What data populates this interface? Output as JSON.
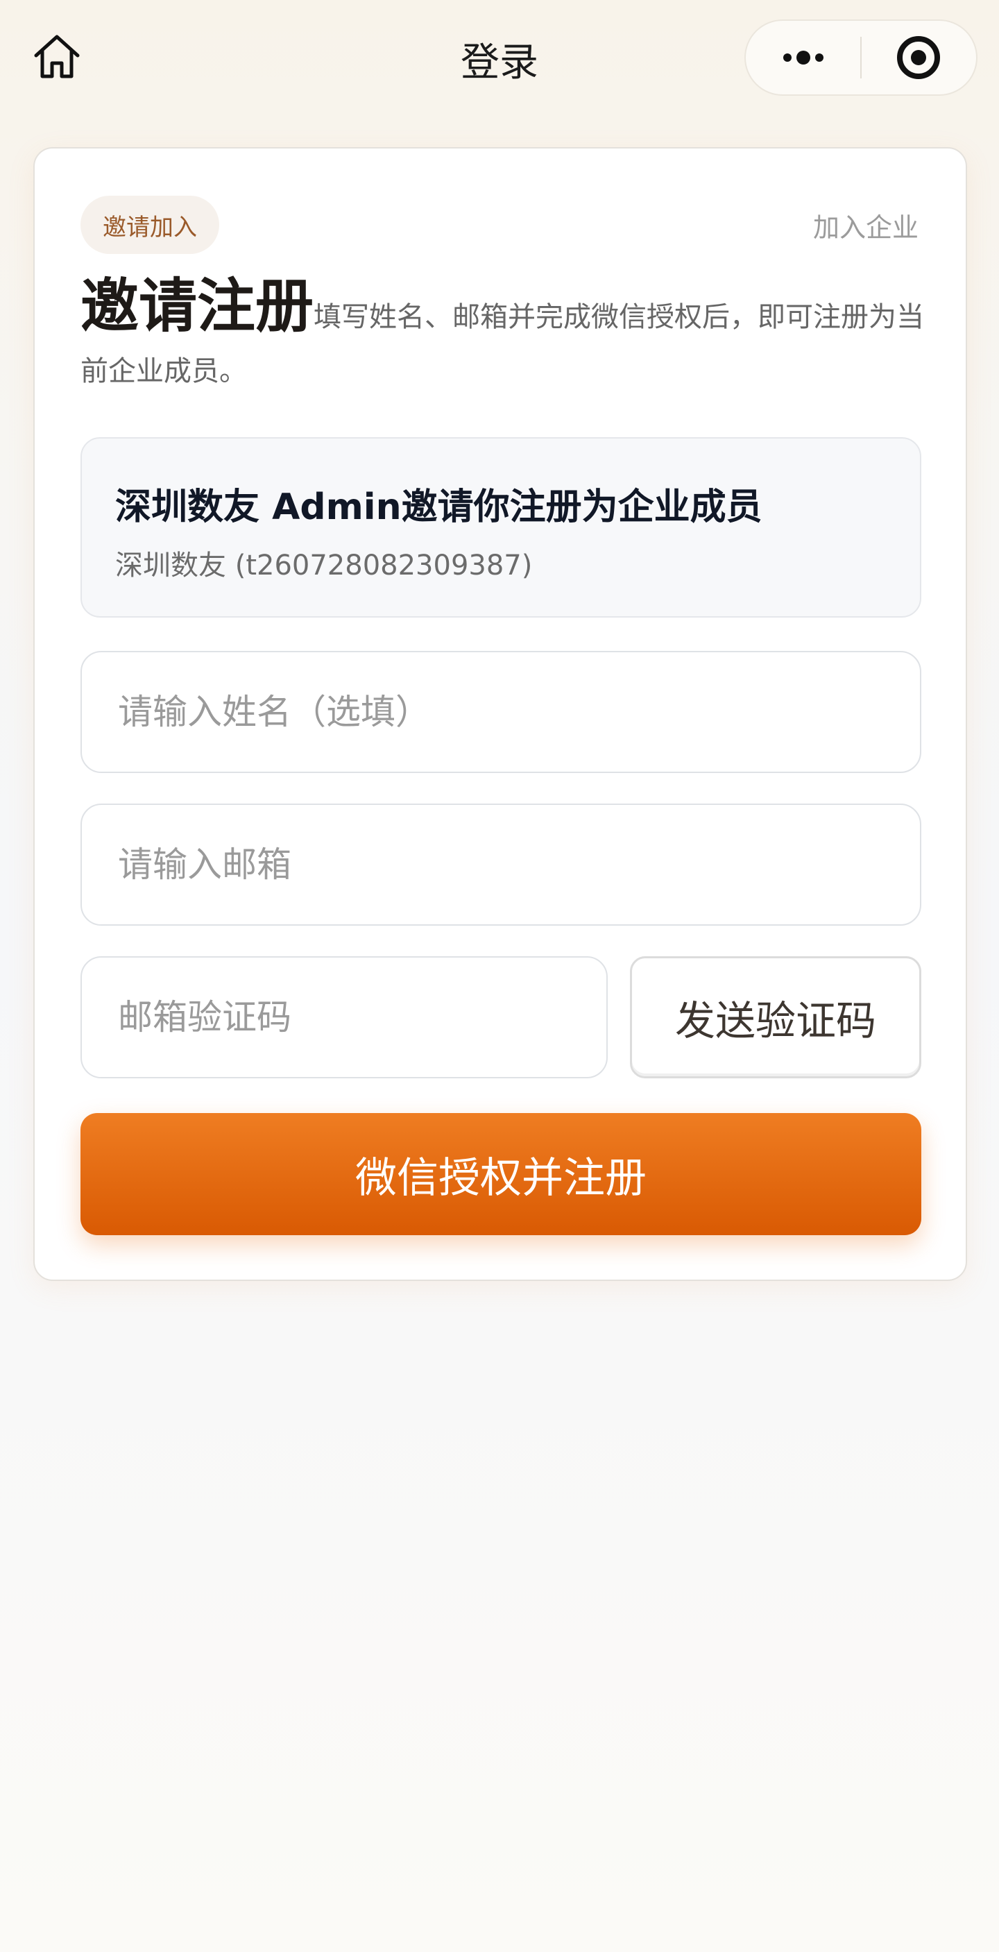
{
  "navbar": {
    "title": "登录",
    "home_icon": "home-icon",
    "more_icon": "more-dots-icon",
    "close_icon": "target-icon"
  },
  "card": {
    "badge": "邀请加入",
    "join_link": "加入企业",
    "headline_big": "邀请注册",
    "headline_desc": "填写姓名、邮箱并完成微信授权后，即可注册为当前企业成员。",
    "invite": {
      "title": "深圳数友 Admin邀请你注册为企业成员",
      "subtitle": "深圳数友 (t260728082309387)"
    },
    "form": {
      "name_placeholder": "请输入姓名（选填）",
      "email_placeholder": "请输入邮箱",
      "code_placeholder": "邮箱验证码",
      "send_code_label": "发送验证码",
      "submit_label": "微信授权并注册"
    }
  },
  "colors": {
    "accent": "#e96a0f",
    "badge_text": "#9a5a2a"
  }
}
